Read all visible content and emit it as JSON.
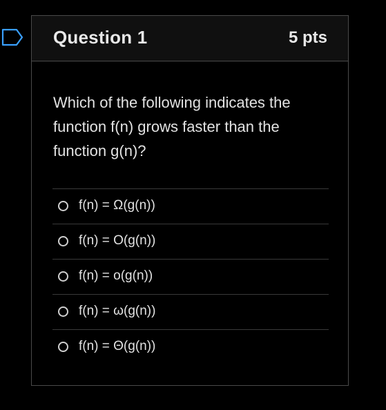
{
  "question": {
    "title": "Question 1",
    "points": "5 pts",
    "text": "Which of the following indicates the function f(n) grows faster than the function g(n)?",
    "answers": [
      {
        "label": "f(n) = Ω(g(n))",
        "selected": false
      },
      {
        "label": "f(n) = O(g(n))",
        "selected": false
      },
      {
        "label": "f(n) = o(g(n))",
        "selected": false
      },
      {
        "label": "f(n) = ω(g(n))",
        "selected": false
      },
      {
        "label": "f(n) = Θ(g(n))",
        "selected": false
      }
    ]
  },
  "colors": {
    "background": "#000000",
    "card_border": "#4a4a4a",
    "header_background": "#101010",
    "text": "#e2e2e2",
    "flag_outline": "#3aa0ff"
  },
  "icons": {
    "flag": "bookmark-flag-icon",
    "radio": "radio-button-icon"
  }
}
